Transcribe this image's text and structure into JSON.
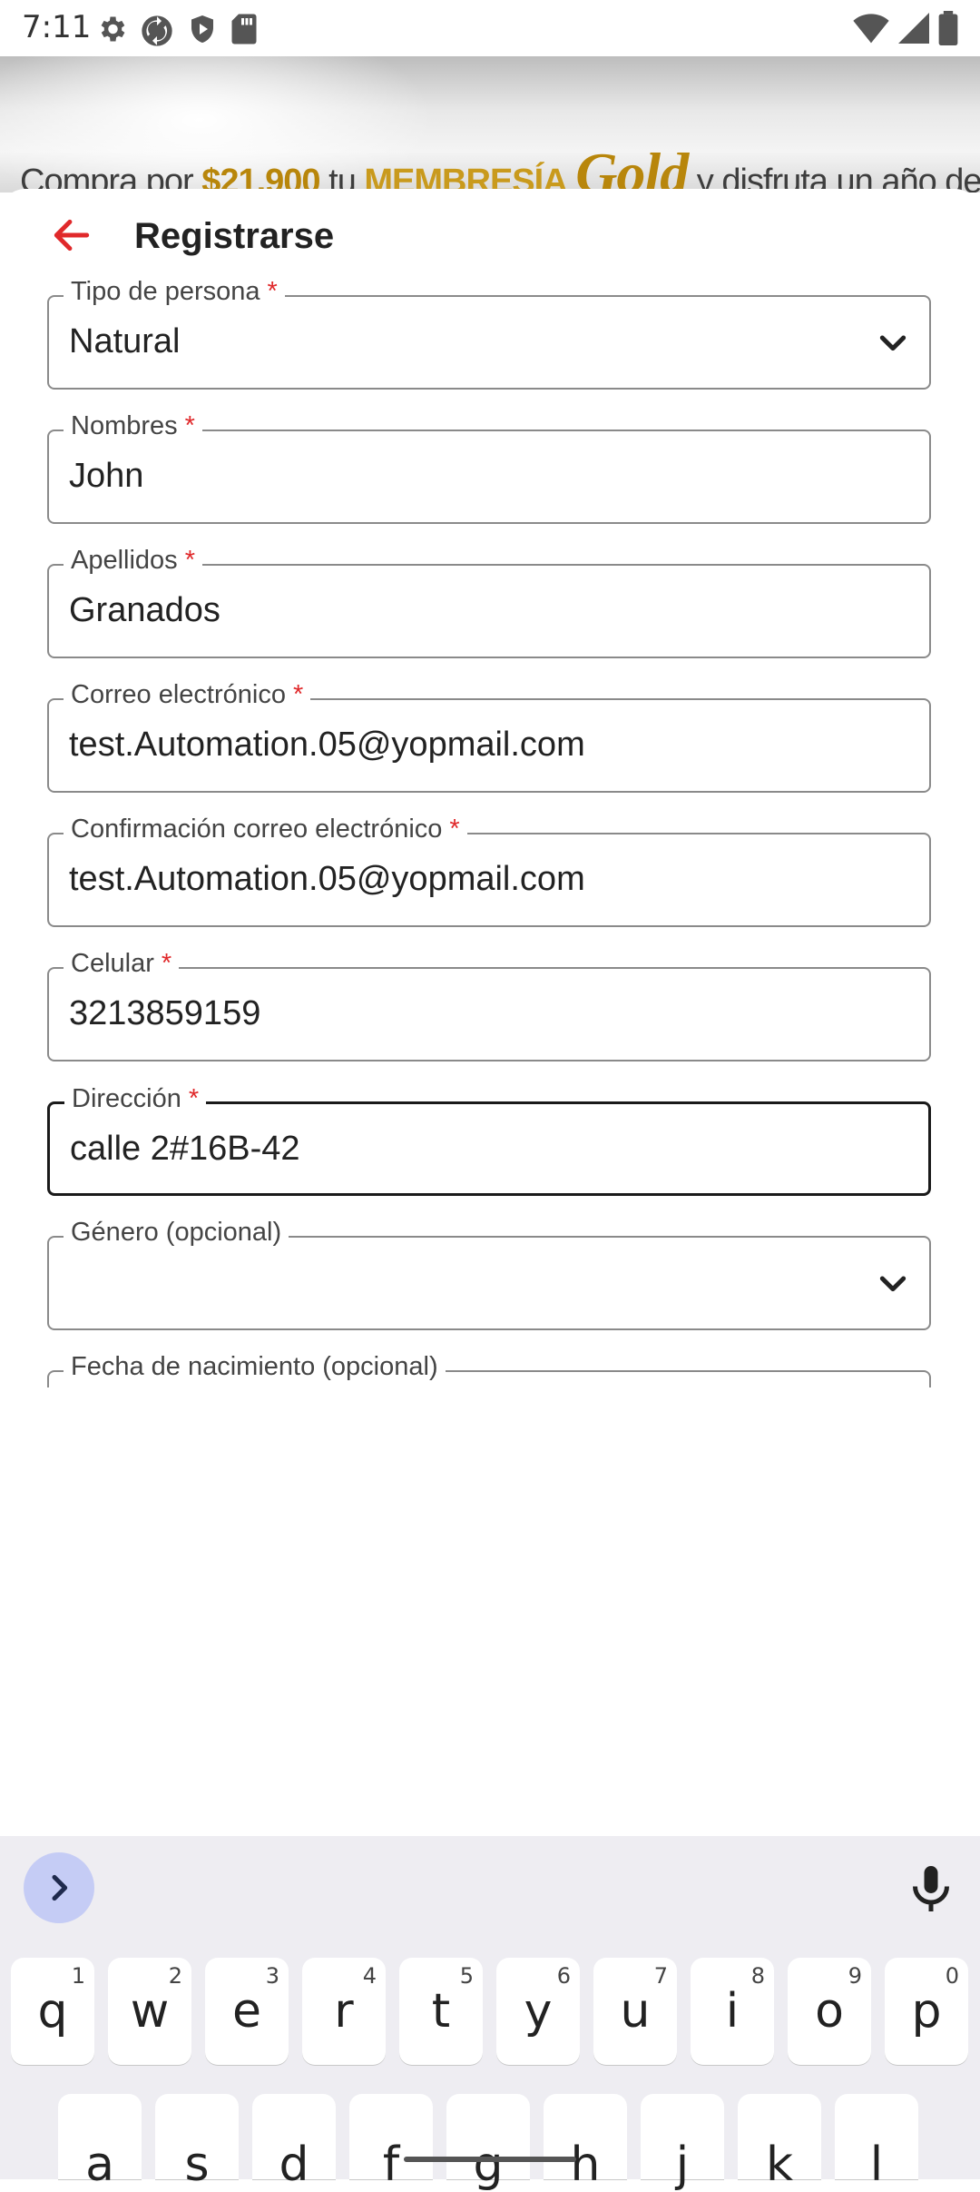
{
  "status_bar": {
    "time": "7:11",
    "left_icons": [
      "gear-icon",
      "sync-icon",
      "shield-icon",
      "sd-card-icon"
    ],
    "right_icons": [
      "wifi-icon",
      "signal-icon",
      "battery-icon"
    ]
  },
  "banner": {
    "text_start": "Compra por",
    "price": "$21.900",
    "text_tu": "tu",
    "membership": "MEMBRESÍA",
    "gold": "Gold",
    "text_end": "y disfruta un año de beneficios"
  },
  "header": {
    "title": "Registrarse"
  },
  "form": {
    "tipo_persona": {
      "label": "Tipo de persona",
      "required_mark": "*",
      "value": "Natural"
    },
    "nombres": {
      "label": "Nombres",
      "required_mark": "*",
      "value": "John"
    },
    "apellidos": {
      "label": "Apellidos",
      "required_mark": "*",
      "value": "Granados"
    },
    "correo": {
      "label": "Correo electrónico",
      "required_mark": "*",
      "value": "test.Automation.05@yopmail.com"
    },
    "confirmacion_correo": {
      "label": "Confirmación correo electrónico",
      "required_mark": "*",
      "value": "test.Automation.05@yopmail.com"
    },
    "celular": {
      "label": "Celular",
      "required_mark": "*",
      "value": "3213859159"
    },
    "direccion": {
      "label": "Dirección",
      "required_mark": "*",
      "value": "calle 2#16B-42"
    },
    "genero": {
      "label": "Género (opcional)",
      "value": ""
    },
    "fecha_nacimiento": {
      "label": "Fecha de nacimiento (opcional)"
    }
  },
  "keyboard": {
    "row1": [
      {
        "key": "q",
        "num": "1"
      },
      {
        "key": "w",
        "num": "2"
      },
      {
        "key": "e",
        "num": "3"
      },
      {
        "key": "r",
        "num": "4"
      },
      {
        "key": "t",
        "num": "5"
      },
      {
        "key": "y",
        "num": "6"
      },
      {
        "key": "u",
        "num": "7"
      },
      {
        "key": "i",
        "num": "8"
      },
      {
        "key": "o",
        "num": "9"
      },
      {
        "key": "p",
        "num": "0"
      }
    ],
    "row2": [
      "a",
      "s",
      "d",
      "f",
      "g",
      "h",
      "j",
      "k",
      "l"
    ]
  },
  "colors": {
    "accent": "#e0292b",
    "keyboard_bg": "#eeedf2",
    "next_button_bg": "#c5ccf5"
  }
}
